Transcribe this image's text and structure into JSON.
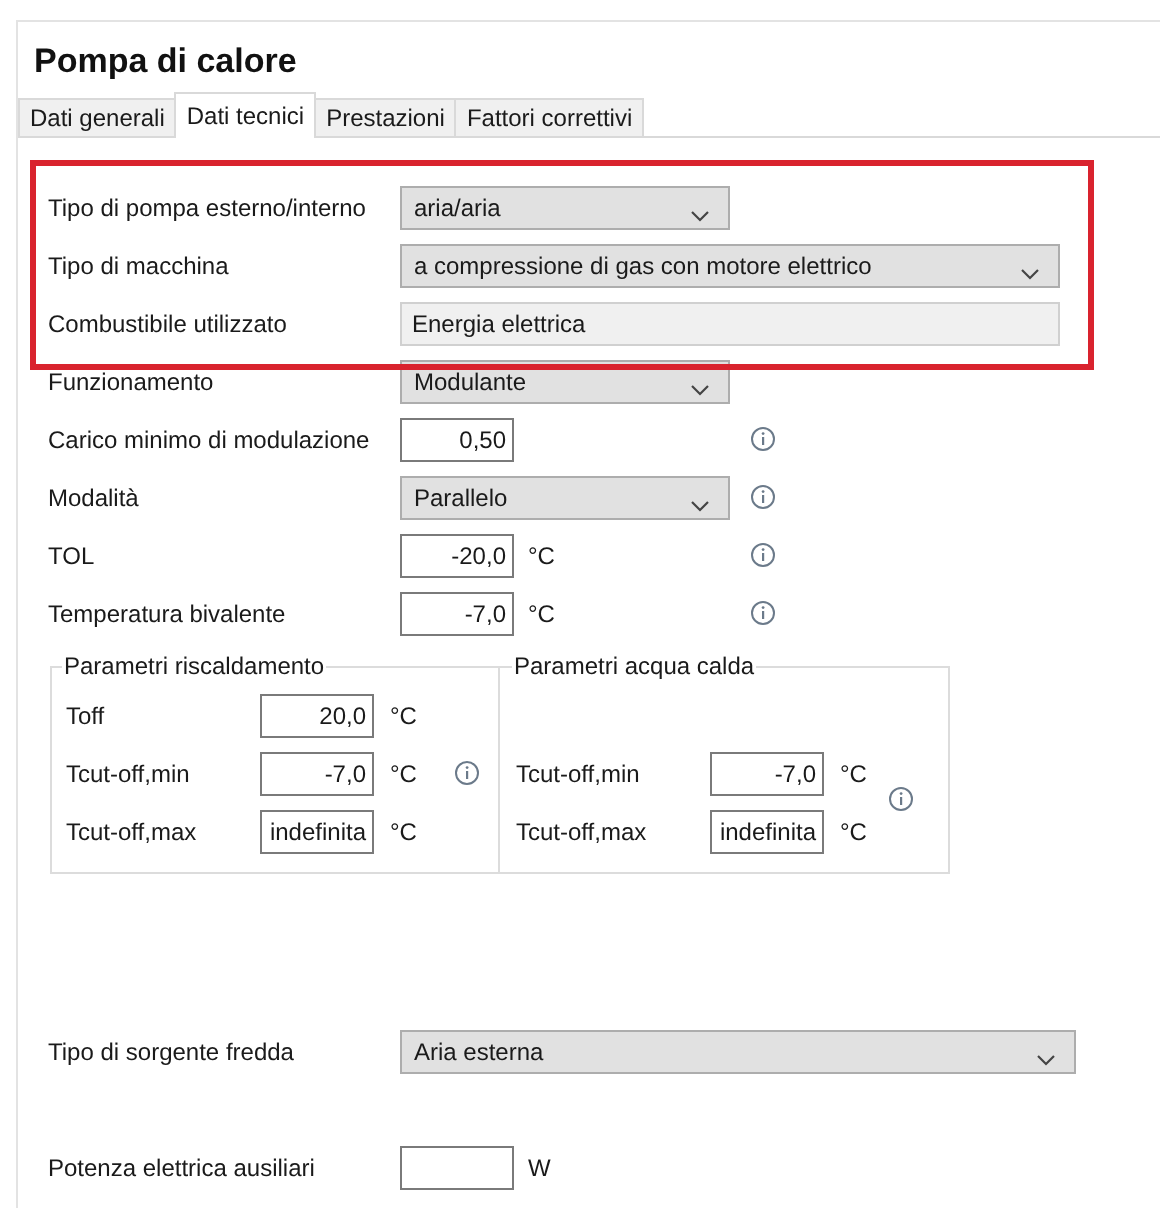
{
  "title": "Pompa di calore",
  "tabs": [
    {
      "label": "Dati generali",
      "selected": false
    },
    {
      "label": "Dati tecnici",
      "selected": true
    },
    {
      "label": "Prestazioni",
      "selected": false
    },
    {
      "label": "Fattori correttivi",
      "selected": false
    }
  ],
  "rows": [
    {
      "label": "Tipo di pompa esterno/interno",
      "kind": "dropdown",
      "value": "aria/aria",
      "wide": false,
      "info": false,
      "highlighted": true
    },
    {
      "label": "Tipo di macchina",
      "kind": "dropdown",
      "value": "a compressione di gas con motore elettrico",
      "wide": true,
      "info": false,
      "highlighted": true
    },
    {
      "label": "Combustibile utilizzato",
      "kind": "readonly",
      "value": "Energia elettrica",
      "wide": true,
      "info": false,
      "highlighted": true
    },
    {
      "label": "Funzionamento",
      "kind": "dropdown",
      "value": "Modulante",
      "wide": false,
      "info": false,
      "highlighted": false
    },
    {
      "label": "Carico minimo di modulazione",
      "kind": "input",
      "value": "0,50",
      "info": true,
      "highlighted": false
    },
    {
      "label": "Modalità",
      "kind": "dropdown",
      "value": "Parallelo",
      "wide": false,
      "info": true,
      "highlighted": false
    },
    {
      "label": "TOL",
      "kind": "input",
      "value": "-20,0",
      "unit": "°C",
      "info": true,
      "highlighted": false
    },
    {
      "label": "Temperatura bivalente",
      "kind": "input",
      "value": "-7,0",
      "unit": "°C",
      "info": true,
      "highlighted": false
    }
  ],
  "groups": [
    {
      "title": "Parametri riscaldamento",
      "info": false,
      "rows": [
        {
          "label": "Toff",
          "value": "20,0",
          "unit": "°C",
          "info": false
        },
        {
          "label": "Tcut-off,min",
          "value": "-7,0",
          "unit": "°C",
          "info": true
        },
        {
          "label": "Tcut-off,max",
          "value": "indefinita",
          "unit": "°C",
          "info": false
        }
      ]
    },
    {
      "title": "Parametri acqua calda",
      "info": true,
      "rows": [
        {
          "label": "Tcut-off,min",
          "value": "-7,0",
          "unit": "°C",
          "info": false
        },
        {
          "label": "Tcut-off,max",
          "value": "indefinita",
          "unit": "°C",
          "info": false
        }
      ]
    }
  ],
  "bottom_rows": [
    {
      "label": "Tipo di sorgente fredda",
      "kind": "dropdown",
      "value": "Aria esterna",
      "wide": true,
      "info": false
    },
    {
      "label": "Potenza elettrica ausiliari",
      "kind": "input",
      "unit": "W",
      "info": false
    }
  ]
}
